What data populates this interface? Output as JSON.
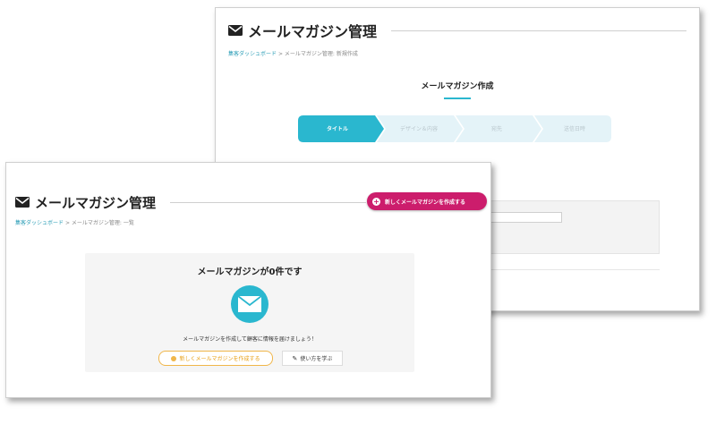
{
  "colors": {
    "accent": "#2ab7cf",
    "primary_button": "#cc1d6c",
    "secondary_button": "#f0b64a",
    "link": "#2a9db6"
  },
  "back_window": {
    "title": "メールマガジン管理",
    "title_icon": "envelope-icon",
    "breadcrumb": {
      "link": "集客ダッシュボード",
      "separator": ">",
      "current": "メールマガジン管理: 新規作成"
    },
    "page_heading": "メールマガジン作成",
    "steps": [
      {
        "label": "タイトル",
        "active": true
      },
      {
        "label": "デザイン＆内容",
        "active": false
      },
      {
        "label": "宛先",
        "active": false
      },
      {
        "label": "送信日時",
        "active": false
      }
    ]
  },
  "front_window": {
    "title": "メールマガジン管理",
    "title_icon": "envelope-icon",
    "new_button_label": "新しくメールマガジンを作成する",
    "breadcrumb": {
      "link": "集客ダッシュボード",
      "separator": ">",
      "current": "メールマガジン管理: 一覧"
    },
    "empty_state": {
      "title": "メールマガジンが0件です",
      "icon": "envelope-icon",
      "description": "メールマガジンを作成して顧客に情報を届けましょう！",
      "create_button_label": "新しくメールマガジンを作成する",
      "howto_button_label": "使い方を学ぶ"
    }
  }
}
